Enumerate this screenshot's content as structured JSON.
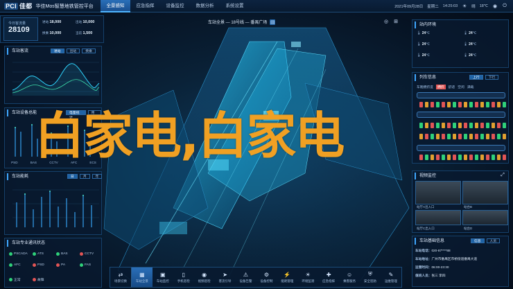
{
  "app": {
    "logo_brand": "PCI",
    "logo_tag": "佳都",
    "title": "华佳Mos智慧地铁管控平台"
  },
  "nav": {
    "items": [
      {
        "label": "全景感知",
        "active": true
      },
      {
        "label": "应急指挥",
        "active": false
      },
      {
        "label": "设备监控",
        "active": false
      },
      {
        "label": "数据分析",
        "active": false
      },
      {
        "label": "系统设置",
        "active": false
      }
    ]
  },
  "topright": {
    "date": "2021年09月28日",
    "weekday": "星期二",
    "time": "14:25:03",
    "weather": "晴",
    "temp": "18℃"
  },
  "left": {
    "stat": {
      "label": "今日客流量",
      "value": "28109",
      "in_label": "进站",
      "in_value": "18,000",
      "out_label": "出站",
      "out_value": "10,000",
      "in2_label": "换乘",
      "in2_value": "10,000",
      "out2_label": "当前",
      "out2_value": "1,500"
    },
    "trend": {
      "title": "车站客流",
      "tabs": [
        {
          "label": "进站",
          "active": true
        },
        {
          "label": "出站",
          "active": false
        },
        {
          "label": "换乘",
          "active": false
        }
      ]
    },
    "energy": {
      "title": "车站设备总能",
      "tabs": [
        {
          "label": "电量统计",
          "active": true
        },
        {
          "label": "用水",
          "active": false
        }
      ],
      "categories": [
        "PSD",
        "BAS",
        "CCTV",
        "AFC",
        "ECS"
      ]
    },
    "energy2": {
      "title": "车站能耗",
      "tabs": [
        {
          "label": "日",
          "active": true
        },
        {
          "label": "月",
          "active": false
        },
        {
          "label": "年",
          "active": false
        }
      ]
    },
    "status": {
      "title": "车站专业通讯状态",
      "items": [
        {
          "label": "PSCADA",
          "color": "#2fd27a"
        },
        {
          "label": "ATS",
          "color": "#2fd27a"
        },
        {
          "label": "BAS",
          "color": "#2fd27a"
        },
        {
          "label": "CCTV",
          "color": "#e25555"
        },
        {
          "label": "AFC",
          "color": "#2fd27a"
        },
        {
          "label": "PSD",
          "color": "#e25555"
        },
        {
          "label": "PA",
          "color": "#e25555"
        },
        {
          "label": "FAS",
          "color": "#2fd27a"
        }
      ],
      "legend_normal": "正常",
      "legend_fault": "故障"
    }
  },
  "center": {
    "breadcrumb": "车站全景 — 18号线 — 番禺广场",
    "overlay_text": "白家电,白家电"
  },
  "right": {
    "env": {
      "title": "站内环境",
      "rows": [
        {
          "a": "24",
          "b": "24"
        },
        {
          "a": "24",
          "b": "24"
        },
        {
          "a": "24",
          "b": "24"
        }
      ],
      "unit": "℃"
    },
    "train": {
      "title": "列车信息",
      "tabs": [
        {
          "label": "上行",
          "active": true
        },
        {
          "label": "下行",
          "active": false
        }
      ],
      "sub_label": "车厢拥挤度",
      "badges": [
        "拥挤",
        "舒适",
        "空闲",
        "满载"
      ]
    },
    "cctv": {
      "title": "视频监控",
      "cams": [
        "站厅A出入口",
        "站台B",
        "站厅C出入口",
        "站台D"
      ]
    },
    "info": {
      "title": "车站基础信息",
      "tabs": [
        {
          "label": "信息",
          "active": true
        },
        {
          "label": "人员",
          "active": false
        }
      ],
      "rows": [
        {
          "k": "车站电话：",
          "v": "020-87****88"
        },
        {
          "k": "车站地址：",
          "v": "广州市番禺区市桥街道番禺大道"
        },
        {
          "k": "运营时间：",
          "v": "06:00-23:30"
        },
        {
          "k": "值班人员：",
          "v": "张三 李四"
        }
      ]
    }
  },
  "dock": {
    "items": [
      {
        "label": "场景切换",
        "icon": "swap-icon",
        "glyph": "⇄",
        "active": false
      },
      {
        "label": "车站全景",
        "icon": "station-icon",
        "glyph": "▦",
        "active": true
      },
      {
        "label": "车站监控",
        "icon": "monitor-icon",
        "glyph": "▣",
        "active": false
      },
      {
        "label": "手机巡检",
        "icon": "phone-icon",
        "glyph": "▯",
        "active": false
      },
      {
        "label": "视频巡检",
        "icon": "video-icon",
        "glyph": "◉",
        "active": false
      },
      {
        "label": "客流引导",
        "icon": "guide-icon",
        "glyph": "➤",
        "active": false
      },
      {
        "label": "设备告警",
        "icon": "alarm-icon",
        "glyph": "⚠",
        "active": false
      },
      {
        "label": "设备控制",
        "icon": "gear-icon",
        "glyph": "⚙",
        "active": false
      },
      {
        "label": "能耗管理",
        "icon": "energy-icon",
        "glyph": "⚡",
        "active": false
      },
      {
        "label": "环境监测",
        "icon": "env-icon",
        "glyph": "☀",
        "active": false
      },
      {
        "label": "应急指挥",
        "icon": "emergency-icon",
        "glyph": "✚",
        "active": false
      },
      {
        "label": "乘客服务",
        "icon": "service-icon",
        "glyph": "☺",
        "active": false
      },
      {
        "label": "安全巡防",
        "icon": "shield-icon",
        "glyph": "⛨",
        "active": false
      },
      {
        "label": "运维管理",
        "icon": "tool-icon",
        "glyph": "✎",
        "active": false
      }
    ]
  }
}
